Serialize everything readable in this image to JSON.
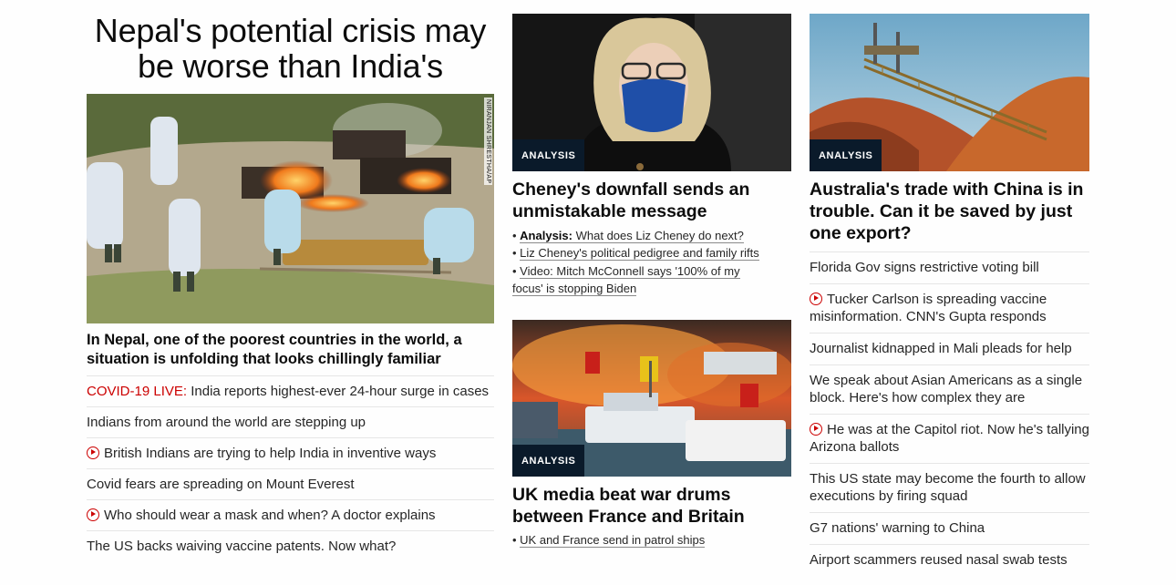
{
  "left": {
    "headline": "Nepal's potential crisis may be worse than India's",
    "photo_credit": "NIRANJAN SHRESTHA/AP",
    "subheadline": "In Nepal, one of the poorest countries in the world, a situation is unfolding that looks chillingly familiar",
    "stories": [
      {
        "prefix": "COVID-19 LIVE:",
        "text": " India reports highest-ever 24-hour surge in cases",
        "video": false
      },
      {
        "prefix": "",
        "text": "Indians from around the world are stepping up",
        "video": false
      },
      {
        "prefix": "",
        "text": "British Indians are trying to help India in inventive ways",
        "video": true
      },
      {
        "prefix": "",
        "text": "Covid fears are spreading on Mount Everest",
        "video": false
      },
      {
        "prefix": "",
        "text": "Who should wear a mask and when? A doctor explains",
        "video": true
      },
      {
        "prefix": "",
        "text": "The US backs waiving vaccine patents. Now what?",
        "video": false
      }
    ]
  },
  "middle": {
    "card1": {
      "badge": "ANALYSIS",
      "headline": "Cheney's downfall sends an unmistakable message",
      "bullet1_label": "Analysis:",
      "bullet1_text": "What does Liz Cheney do next?",
      "bullet2": "Liz Cheney's political pedigree and family rifts",
      "bullet3a": "Video: Mitch McConnell says '100% of my",
      "bullet3b": "focus' is stopping Biden"
    },
    "card2": {
      "badge": "ANALYSIS",
      "headline": "UK media beat war drums between France and Britain",
      "bullet1": "UK and France send in patrol ships"
    }
  },
  "right": {
    "badge": "ANALYSIS",
    "headline": "Australia's trade with China is in trouble. Can it be saved by just one export?",
    "stories": [
      {
        "text": "Florida Gov signs restrictive voting bill",
        "video": false
      },
      {
        "text": "Tucker Carlson is spreading vaccine misinformation. CNN's Gupta responds",
        "video": true
      },
      {
        "text": "Journalist kidnapped in Mali pleads for help",
        "video": false
      },
      {
        "text": "We speak about Asian Americans as a single block. Here's how complex they are",
        "video": false
      },
      {
        "text": "He was at the Capitol riot. Now he's tallying Arizona ballots",
        "video": true
      },
      {
        "text": "This US state may become the fourth to allow executions by firing squad",
        "video": false
      },
      {
        "text": "G7 nations' warning to China",
        "video": false
      },
      {
        "text": "Airport scammers reused nasal swab tests",
        "video": false
      }
    ]
  },
  "colors": {
    "live_red": "#cc0000",
    "badge_bg": "#0a1a2a",
    "divider": "#e6e6e6"
  },
  "icons": {
    "video": "play-circle-icon"
  }
}
